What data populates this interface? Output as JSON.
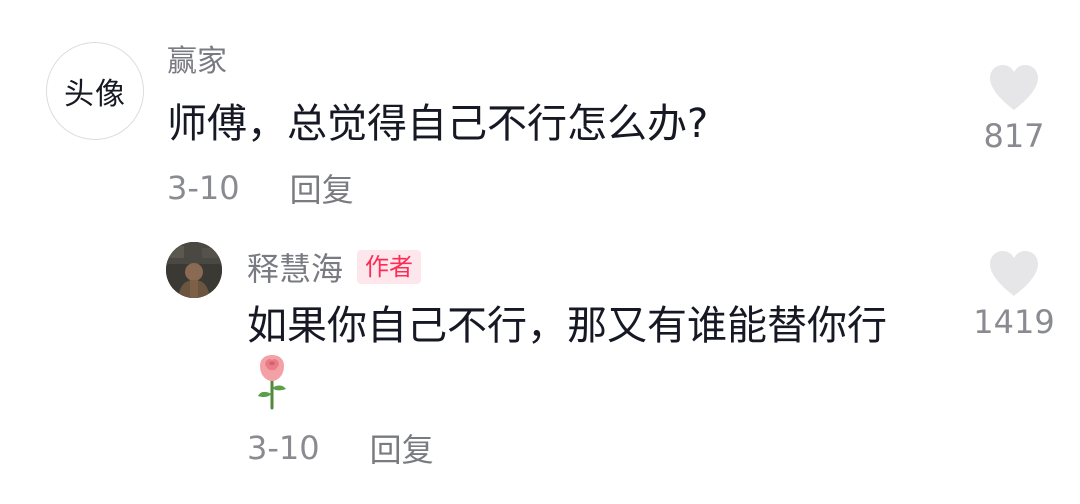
{
  "comment": {
    "avatar_text": "头像",
    "username": "赢家",
    "text": "师傅，总觉得自己不行怎么办?",
    "date": "3-10",
    "reply_label": "回复",
    "like_count": "817",
    "like_icon": "heart-icon"
  },
  "reply": {
    "username": "释慧海",
    "author_badge": "作者",
    "text": "如果你自己不行，那又有谁能替你行",
    "emoji_icon": "rose-emoji",
    "date": "3-10",
    "reply_label": "回复",
    "like_count": "1419",
    "like_icon": "heart-icon"
  },
  "colors": {
    "text_primary": "#161823",
    "text_secondary": "#8a8b91",
    "badge_text": "#fe2c55",
    "badge_bg": "#fde7ec",
    "heart": "#e6e6e8"
  }
}
